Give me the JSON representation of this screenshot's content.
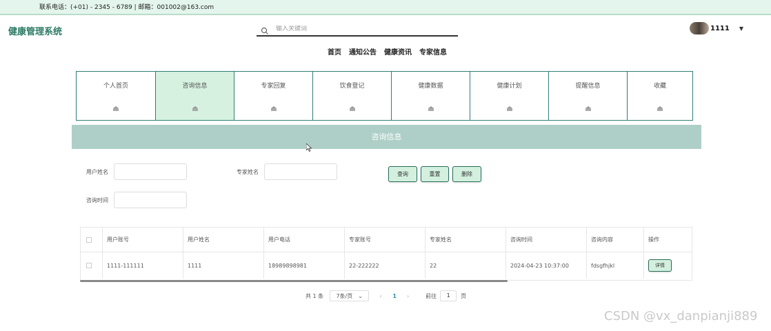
{
  "topbar": {
    "contact": "联系电话：(+01) - 2345 - 6789 | 邮箱：001002@163.com"
  },
  "header": {
    "logo": "健康管理系统",
    "search_placeholder": "输入关键词",
    "username": "1111",
    "nav": [
      "首页",
      "通知公告",
      "健康资讯",
      "专家信息"
    ]
  },
  "tiles": [
    "个人首页",
    "咨询信息",
    "专家回复",
    "饮食登记",
    "健康数据",
    "健康计划",
    "提醒信息",
    "收藏"
  ],
  "active_tile": "咨询信息",
  "banner_title": "咨询信息",
  "filters": {
    "user_name_label": "用户姓名",
    "expert_name_label": "专家姓名",
    "consult_time_label": "咨询时间",
    "user_name_value": "",
    "expert_name_value": "",
    "consult_time_value": ""
  },
  "buttons": {
    "query": "查询",
    "reset": "重置",
    "delete": "删除"
  },
  "table": {
    "columns": [
      "用户账号",
      "用户姓名",
      "用户电话",
      "专家账号",
      "专家姓名",
      "咨询时间",
      "咨询内容",
      "操作"
    ],
    "rows": [
      {
        "user_account": "1111-111111",
        "user_name": "1111",
        "phone": "18989898981",
        "expert_account": "22-222222",
        "expert_name": "22",
        "consult_time": "2024-04-23 10:37:00",
        "content": "fdsgfhjkl",
        "action": "详情"
      }
    ]
  },
  "pagination": {
    "total": "共 1 条",
    "page_size": "7条/页",
    "current_page": "1",
    "goto_label": "前往",
    "goto_value": "1",
    "page_unit": "页"
  },
  "watermark": "CSDN @vx_danpianji889",
  "colors": {
    "accent": "#2b7a63",
    "tile_active": "#d6f1e0",
    "banner": "#aecfc7",
    "button_bg": "#d3f0df"
  }
}
